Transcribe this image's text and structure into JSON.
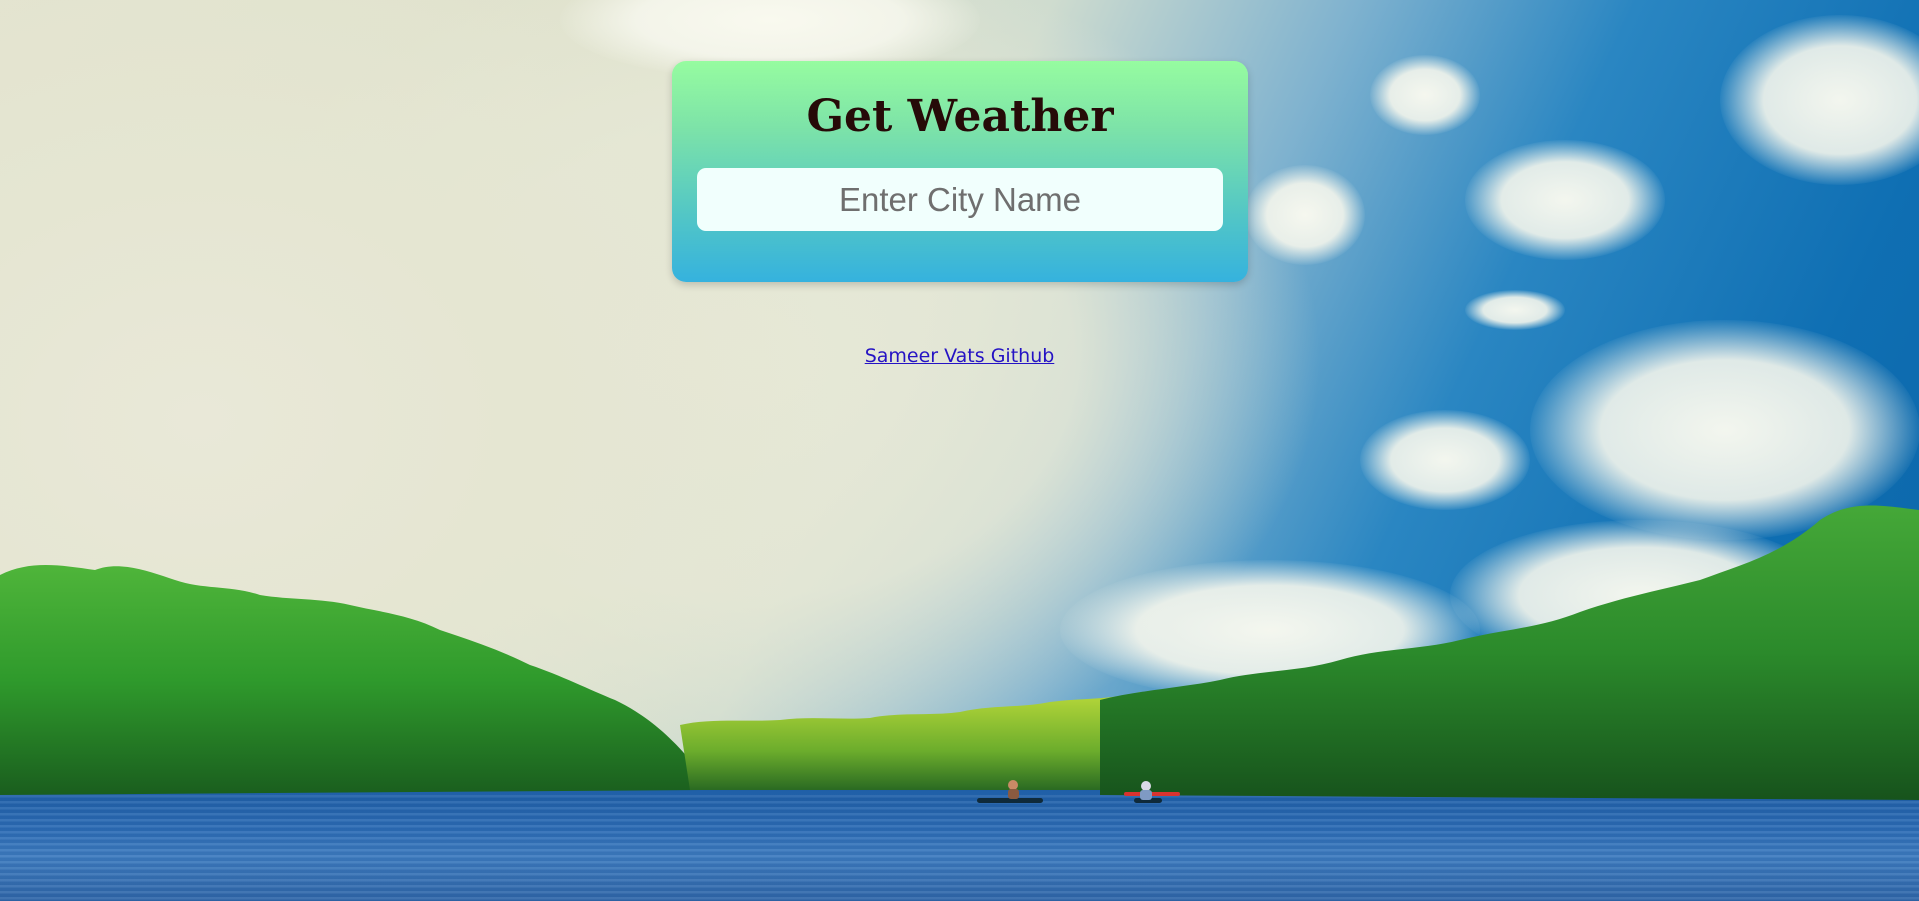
{
  "card": {
    "title": "Get Weather",
    "search": {
      "placeholder": "Enter City Name",
      "value": ""
    }
  },
  "footer": {
    "link_text": "Sameer Vats Github"
  },
  "colors": {
    "card_gradient_top": "#96fca0",
    "card_gradient_bottom": "#35b2de",
    "title_color": "#260a08",
    "input_background": "#f1fffd",
    "link_color": "#2513c4"
  }
}
